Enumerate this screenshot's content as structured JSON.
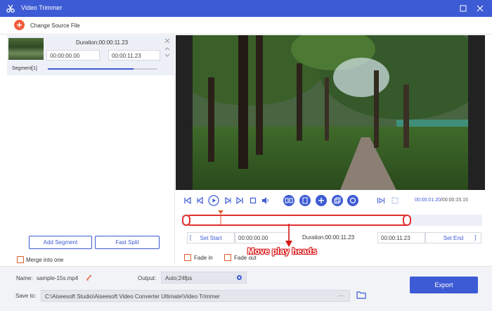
{
  "window": {
    "title": "Video Trimmer"
  },
  "toolbar": {
    "change_source_label": "Change Source File"
  },
  "segment": {
    "duration": "Duration:00:00:11.23",
    "start_time": "00:00:00.00",
    "end_time": "00:00:11.23",
    "label": "Segment[1]",
    "progress": 0.79
  },
  "left_actions": {
    "add_segment_label": "Add Segment",
    "fast_split_label": "Fast Split",
    "merge_label": "Merge into one"
  },
  "player": {
    "current_time": "00:00:01.20",
    "total_time": "/00:00:15.15"
  },
  "trim": {
    "set_start_label": "Set Start",
    "start_value": "00:00:00.00",
    "duration": "Duration:00:00:11.23",
    "end_value": "00:00:11.23",
    "set_end_label": "Set End",
    "fade_in_label": "Fade in",
    "fade_out_label": "Fade out",
    "annotation": "Move play heads"
  },
  "output": {
    "name_label": "Name:",
    "name_value": "sample-15s.mp4",
    "output_label": "Output:",
    "output_value": "Auto;24fps",
    "save_label": "Save to:",
    "save_path": "C:\\Aiseesoft Studio\\Aiseesoft Video Converter Ultimate\\Video Trimmer",
    "browse_label": "···",
    "export_label": "Export"
  },
  "colors": {
    "accent": "#3d5bd4",
    "highlight": "#e03030",
    "add_button": "#f35a3a"
  }
}
